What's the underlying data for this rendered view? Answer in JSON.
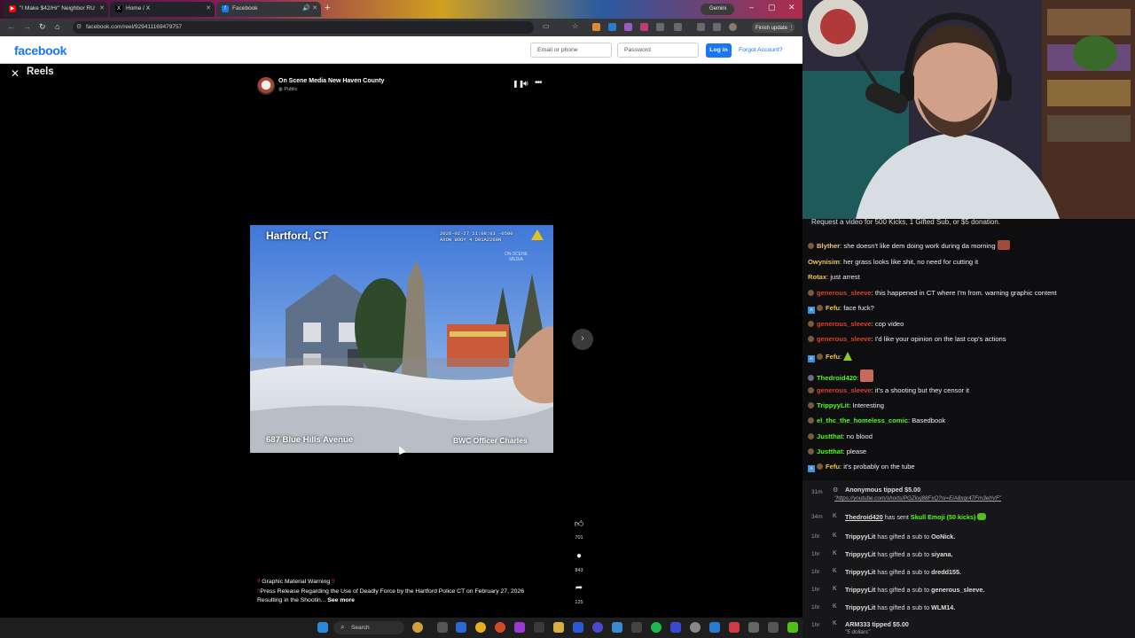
{
  "browser": {
    "tabs": [
      {
        "title": "\"I Make $42/Hr\" Neighbor RU",
        "icon_color": "#ff0000"
      },
      {
        "title": "Home / X",
        "icon_color": "#000000"
      },
      {
        "title": "Facebook",
        "icon_color": "#1877f2"
      }
    ],
    "gemini_label": "Gemini",
    "url": "facebook.com/reel/929411169479757",
    "finish_update_label": "Finish update"
  },
  "fb_header": {
    "logo": "facebook",
    "email_placeholder": "Email or phone",
    "password_placeholder": "Password",
    "login_label": "Log in",
    "forgot_label": "Forgot Account?"
  },
  "reels": {
    "title": "Reels",
    "author": "On Scene Media New Haven County",
    "audience": "Public",
    "video": {
      "location_overlay": "Hartford, CT",
      "bodycam_line1": "2026-02-27 11:08:03 -0500",
      "bodycam_line2": "AXON BODY 4 D01A2269N",
      "watermark": "ON SCENE MEDIA",
      "address_overlay": "687 Blue Hills Avenue",
      "officer_overlay": "BWC Officer Charles"
    },
    "likes": "701",
    "comments": "843",
    "shares": "125",
    "warning_title": "Graphic Material Warning",
    "caption": "Press Release Regarding the Use of Deadly Force by the Hartford Police CT on February 27, 2026 Resulting in the Shootin...",
    "see_more": "See more"
  },
  "taskbar": {
    "search_label": "Search"
  },
  "chat": {
    "banner": "Request a video for 500 Kicks, 1 Gifted Sub, or $5 donation.",
    "messages": [
      {
        "user": "Blyther",
        "color": "#f0c080",
        "text": "she doesn't like dem doing work during da morning",
        "badge": "round",
        "emote": true
      },
      {
        "user": "Owynisim",
        "color": "#f0c060",
        "text": "her grass looks like shit, no need for cutting it",
        "badge": "none"
      },
      {
        "user": "Rotax",
        "color": "#f0c040",
        "text": "just arrest",
        "badge": "none"
      },
      {
        "user": "generous_sleeve",
        "color": "#e0402a",
        "text": "this happened in CT where I'm from. warning graphic content",
        "badge": "round"
      },
      {
        "user": "Fefu",
        "color": "#f0c040",
        "text": "face fuck?",
        "badge": "both"
      },
      {
        "user": "generous_sleeve",
        "color": "#e0402a",
        "text": "cop video",
        "badge": "round"
      },
      {
        "user": "generous_sleeve",
        "color": "#e0402a",
        "text": "I'd like your opinion on the last cop's actions",
        "badge": "round"
      },
      {
        "user": "Fefu",
        "color": "#f0c040",
        "text": "",
        "badge": "both",
        "emote": true
      },
      {
        "user": "Thedroid420",
        "color": "#53fc18",
        "text": "",
        "badge": "round",
        "emote": true
      },
      {
        "user": "generous_sleeve",
        "color": "#e0402a",
        "text": "it's a shooting but they censor it",
        "badge": "round"
      },
      {
        "user": "TrippyyLit",
        "color": "#53fc18",
        "text": "Interesting",
        "badge": "round"
      },
      {
        "user": "el_thc_the_homeless_comic",
        "color": "#53fc18",
        "text": "Basedbook",
        "badge": "round"
      },
      {
        "user": "Justthat",
        "color": "#53fc18",
        "text": "no blood",
        "badge": "round"
      },
      {
        "user": "Justthat",
        "color": "#53fc18",
        "text": "please",
        "badge": "round"
      },
      {
        "user": "Fefu",
        "color": "#f0c040",
        "text": "it's probably on the tube",
        "badge": "both"
      }
    ],
    "events": [
      {
        "time": "31m",
        "line1": "Anonymous tipped $5.00",
        "line2": "\"https://youtube.com/shorts/PGZkxj88FxQ?si=EiA8xqr47Fm3ehVF\""
      },
      {
        "time": "34m",
        "user": "Thedroid420",
        "text": "has sent",
        "highlight": "Skull Emoji (50 kicks)"
      },
      {
        "time": "1hr",
        "user": "TrippyyLit",
        "text": "has gifted a sub to",
        "target": "OoNick."
      },
      {
        "time": "1hr",
        "user": "TrippyyLit",
        "text": "has gifted a sub to",
        "target": "siyana."
      },
      {
        "time": "1hr",
        "user": "TrippyyLit",
        "text": "has gifted a sub to",
        "target": "dredd155."
      },
      {
        "time": "1hr",
        "user": "TrippyyLit",
        "text": "has gifted a sub to",
        "target": "generous_sleeve."
      },
      {
        "time": "1hr",
        "user": "TrippyyLit",
        "text": "has gifted a sub to",
        "target": "WLM14."
      },
      {
        "time": "1hr",
        "line1": "ARM333 tipped $5.00",
        "line2": "\"5 dollars\""
      }
    ]
  },
  "colors": {
    "fb_blue": "#1877f2",
    "kick_green": "#53fc18"
  }
}
